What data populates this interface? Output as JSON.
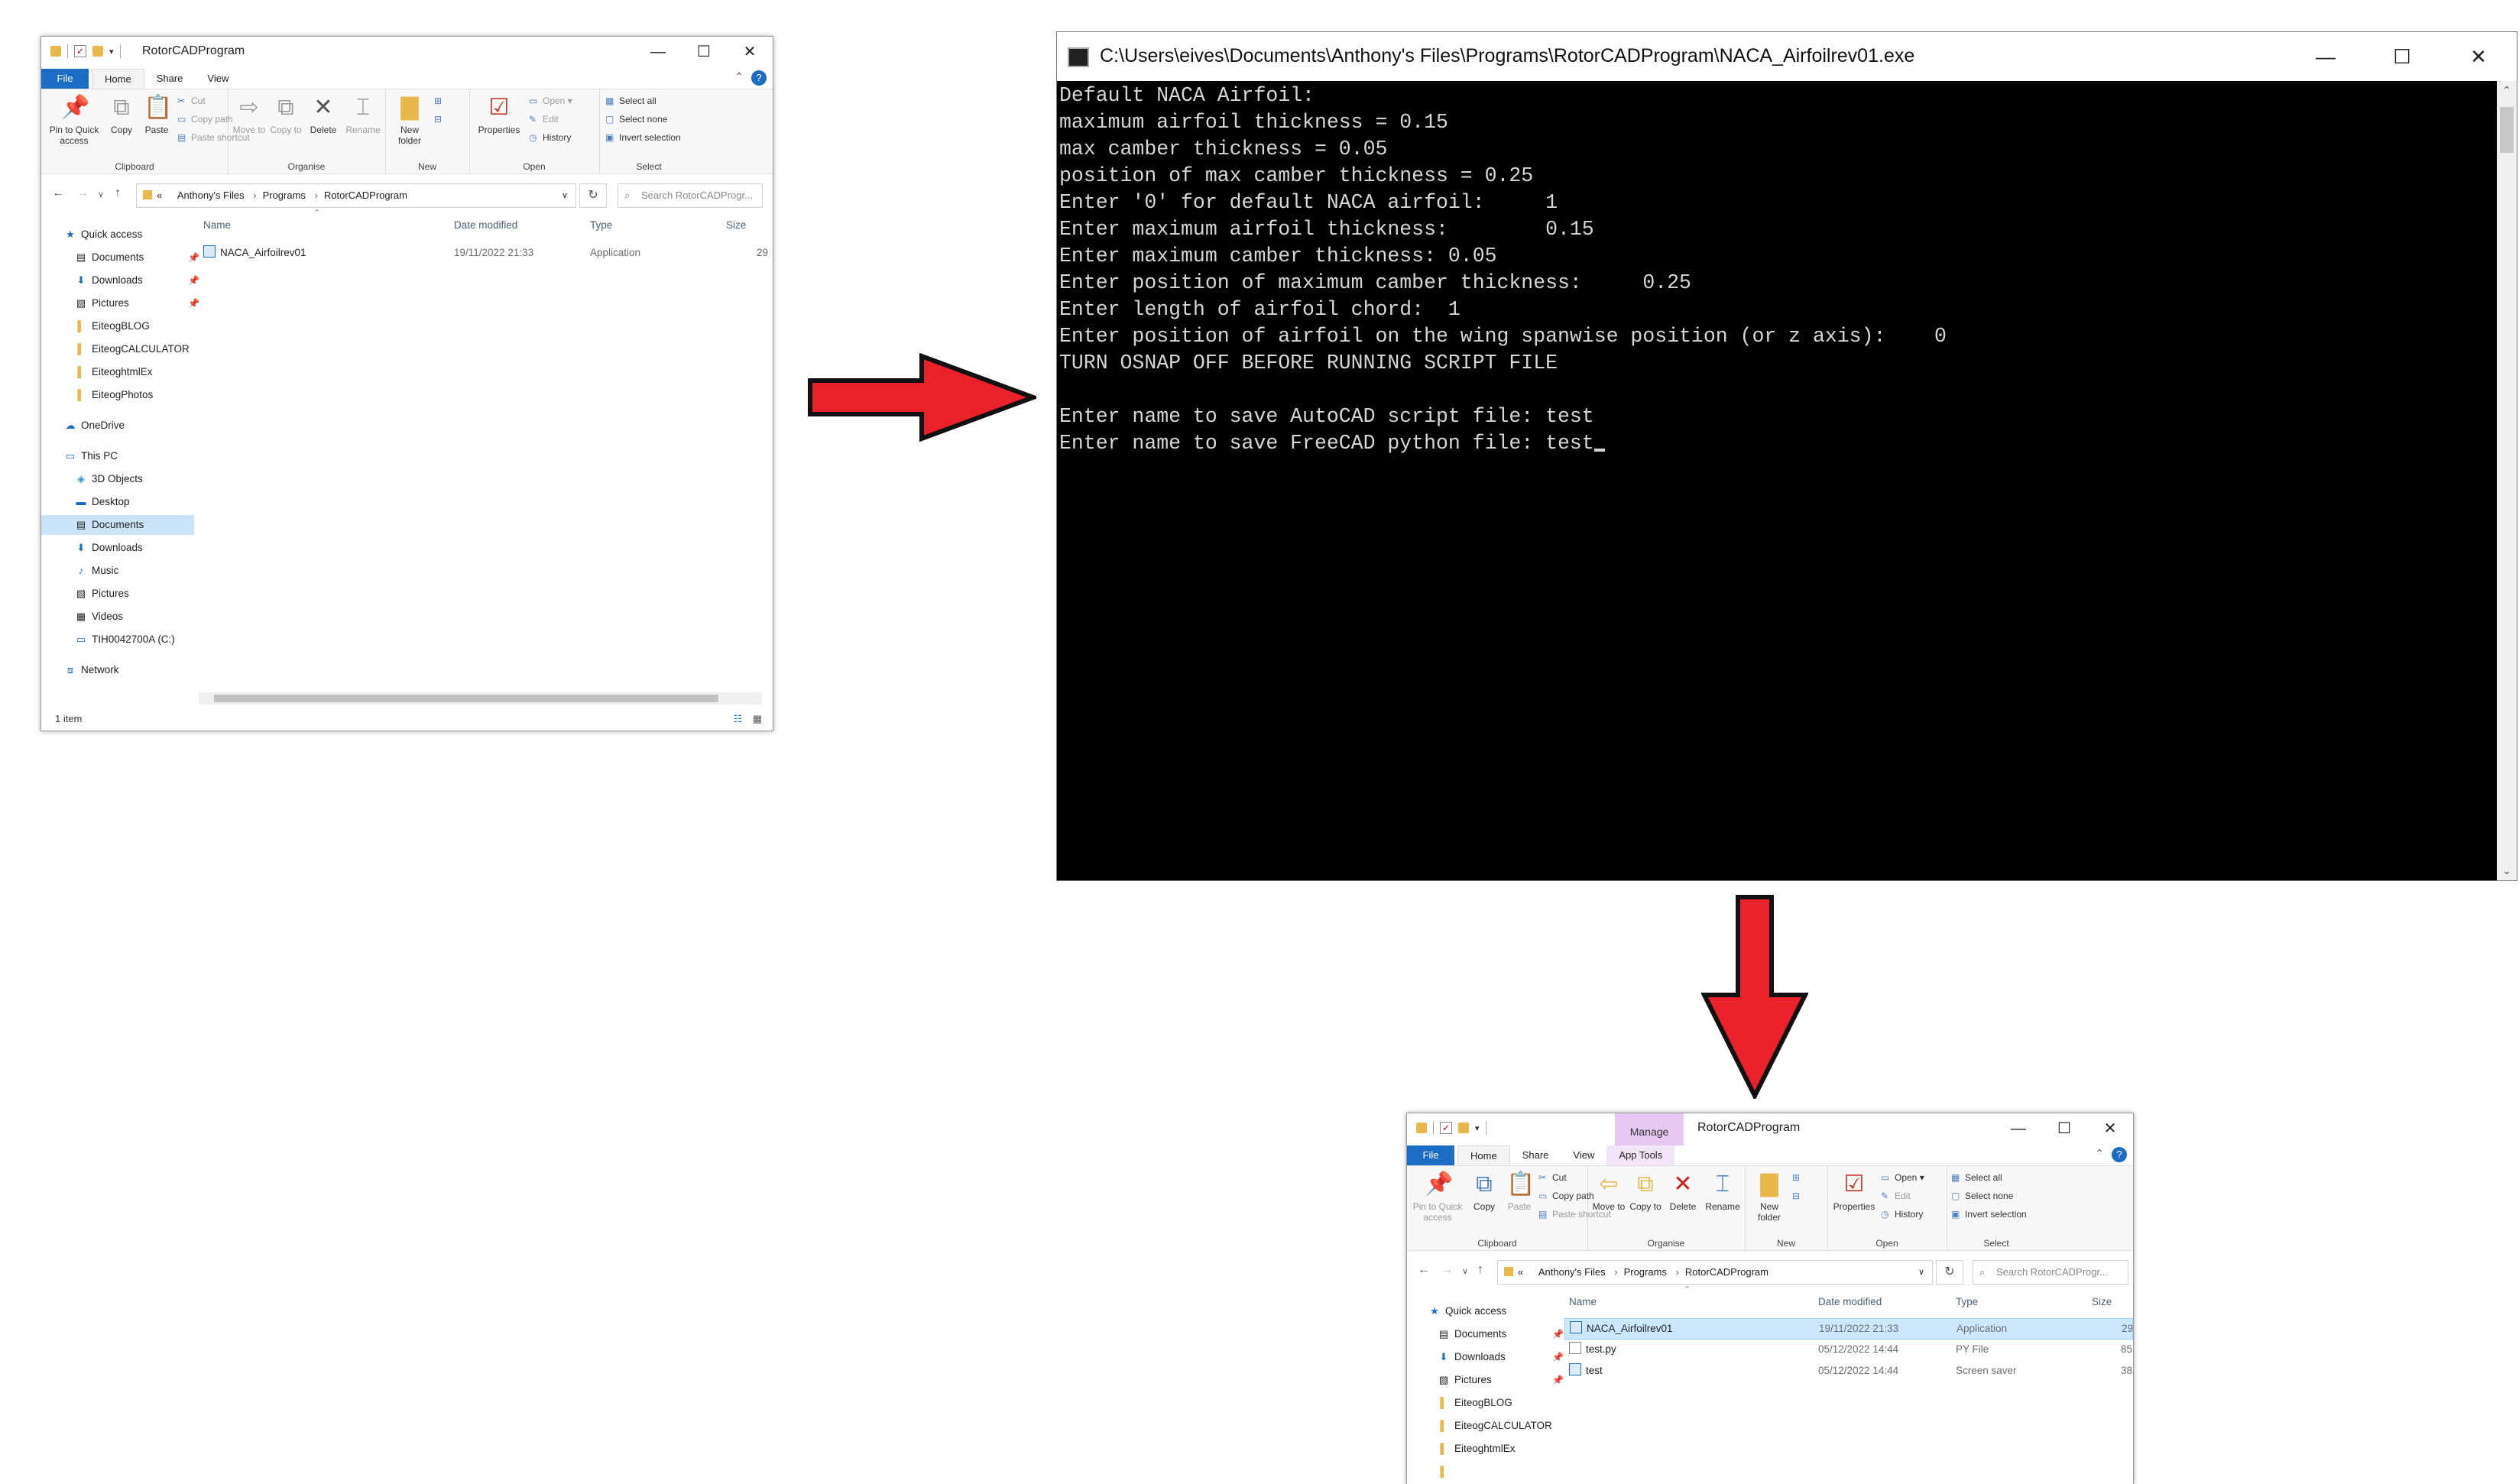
{
  "explorer1": {
    "title": "RotorCADProgram",
    "tabs": [
      "File",
      "Home",
      "Share",
      "View"
    ],
    "ribbon": {
      "pin": "Pin to Quick access",
      "copy": "Copy",
      "paste": "Paste",
      "cut": "Cut",
      "copy_path": "Copy path",
      "paste_shortcut": "Paste shortcut",
      "move_to": "Move to",
      "copy_to": "Copy to",
      "delete": "Delete",
      "rename": "Rename",
      "new_folder": "New folder",
      "properties": "Properties",
      "open": "Open",
      "edit": "Edit",
      "history": "History",
      "select_all": "Select all",
      "select_none": "Select none",
      "invert_selection": "Invert selection",
      "groups": [
        "Clipboard",
        "Organise",
        "New",
        "Open",
        "Select"
      ]
    },
    "address": {
      "root": "«",
      "crumbs": [
        "Anthony's Files",
        "Programs",
        "RotorCADProgram"
      ],
      "search_placeholder": "Search RotorCADProgr..."
    },
    "nav": [
      "Quick access",
      "Documents",
      "Downloads",
      "Pictures",
      "EiteogBLOG",
      "EiteogCALCULATOR",
      "EiteoghtmlEx",
      "EiteogPhotos",
      "OneDrive",
      "This PC",
      "3D Objects",
      "Desktop",
      "Documents",
      "Downloads",
      "Music",
      "Pictures",
      "Videos",
      "TIH0042700A (C:)",
      "Network"
    ],
    "columns": [
      "Name",
      "Date modified",
      "Type",
      "Size"
    ],
    "files": [
      {
        "name": "NACA_Airfoilrev01",
        "date": "19/11/2022 21:33",
        "type": "Application",
        "size": "29"
      }
    ],
    "status": "1 item"
  },
  "console": {
    "title": "C:\\Users\\eives\\Documents\\Anthony's Files\\Programs\\RotorCADProgram\\NACA_Airfoilrev01.exe",
    "lines": [
      "Default NACA Airfoil:",
      "maximum airfoil thickness = 0.15",
      "max camber thickness = 0.05",
      "position of max camber thickness = 0.25",
      "Enter '0' for default NACA airfoil:     1",
      "Enter maximum airfoil thickness:        0.15",
      "Enter maximum camber thickness: 0.05",
      "Enter position of maximum camber thickness:     0.25",
      "Enter length of airfoil chord:  1",
      "Enter position of airfoil on the wing spanwise position (or z axis):    0",
      "TURN OSNAP OFF BEFORE RUNNING SCRIPT FILE",
      "",
      "Enter name to save AutoCAD script file: test",
      "Enter name to save FreeCAD python file: test"
    ]
  },
  "explorer2": {
    "title": "RotorCADProgram",
    "manage": "Manage",
    "tabs": [
      "File",
      "Home",
      "Share",
      "View",
      "App Tools"
    ],
    "address": {
      "root": "«",
      "crumbs": [
        "Anthony's Files",
        "Programs",
        "RotorCADProgram"
      ],
      "search_placeholder": "Search RotorCADProgr..."
    },
    "nav": [
      "Quick access",
      "Documents",
      "Downloads",
      "Pictures",
      "EiteogBLOG",
      "EiteogCALCULATOR",
      "EiteoghtmlEx"
    ],
    "columns": [
      "Name",
      "Date modified",
      "Type",
      "Size"
    ],
    "files": [
      {
        "name": "NACA_Airfoilrev01",
        "date": "19/11/2022 21:33",
        "type": "Application",
        "size": "29"
      },
      {
        "name": "test.py",
        "date": "05/12/2022 14:44",
        "type": "PY File",
        "size": "85"
      },
      {
        "name": "test",
        "date": "05/12/2022 14:44",
        "type": "Screen saver",
        "size": "38"
      }
    ]
  },
  "arrows": {
    "color": "#e8212a",
    "outline": "#111111"
  }
}
